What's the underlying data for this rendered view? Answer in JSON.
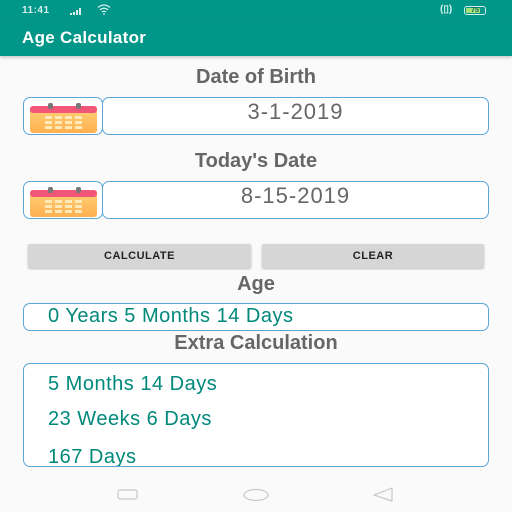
{
  "status_bar": {
    "time": "11:41",
    "signal_icon": "signal-icon",
    "wifi_icon": "wifi-icon",
    "vibrate_icon": "vibrate-icon",
    "vibrate_glyph": "(▯)",
    "battery_level": "75"
  },
  "app_bar": {
    "title": "Age Calculator",
    "color": "#009688"
  },
  "date_of_birth": {
    "label": "Date of Birth",
    "icon": "calendar-icon",
    "value": "3-1-2019"
  },
  "todays_date": {
    "label": "Today's Date",
    "icon": "calendar-icon",
    "value": "8-15-2019"
  },
  "buttons": {
    "calculate": "CALCULATE",
    "clear": "CLEAR"
  },
  "age": {
    "label": "Age",
    "value": "0 Years 5 Months 14 Days"
  },
  "extra_calculation": {
    "label": "Extra Calculation",
    "lines": [
      "5 Months 14 Days",
      "23 Weeks 6 Days",
      "167 Days"
    ]
  },
  "nav_bar": {
    "recents_icon": "recents-icon",
    "home_icon": "home-icon",
    "back_icon": "back-icon"
  },
  "colors": {
    "accent": "#009688",
    "result_text": "#00897b",
    "border": "#5aa6d6",
    "heading_text": "#666666"
  }
}
